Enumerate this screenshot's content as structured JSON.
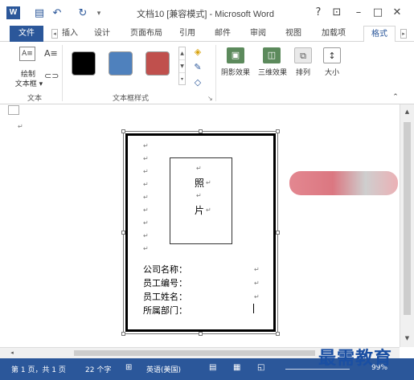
{
  "titlebar": {
    "title": "文档10 [兼容模式] - Microsoft Word",
    "help": "?",
    "ribbon_display": "⊡",
    "minimize": "–",
    "maximize": "□",
    "close": "✕",
    "undo": "↶",
    "redo": "↻",
    "save": "▤",
    "customize": "▾"
  },
  "tabs": {
    "file": "文件",
    "insert": "插入",
    "design": "设计",
    "layout": "页面布局",
    "references": "引用",
    "mailings": "邮件",
    "review": "审阅",
    "view": "视图",
    "addins": "加载项",
    "format": "格式",
    "left_arrow": "◂",
    "right_arrow": "▸"
  },
  "ribbon": {
    "text_group": {
      "draw_textbox": "绘制",
      "draw_textbox_line2": "文本框 ▾",
      "label": "文本"
    },
    "styles_group": {
      "label": "文本框样式",
      "swatch_colors": [
        "#000000",
        "#4f81bd",
        "#c0504d"
      ],
      "launcher": "↘"
    },
    "effects": {
      "shadow": "阴影效果",
      "three_d": "三维效果",
      "arrange": "排列",
      "size": "大小"
    },
    "collapse": "⌃"
  },
  "document": {
    "photo_line1": "照",
    "photo_line2": "片",
    "fields": [
      "公司名称：",
      "员工编号：",
      "员工姓名：",
      "所属部门："
    ],
    "para_mark": "↵"
  },
  "scroll": {
    "up": "▲",
    "down": "▼",
    "left": "◂"
  },
  "status": {
    "page": "第 1 页，共 1 页",
    "words": "22 个字",
    "language": "英语(美国)",
    "zoom": "99%"
  },
  "watermark": "最需教育",
  "colors": {
    "accent": "#2b579a"
  }
}
